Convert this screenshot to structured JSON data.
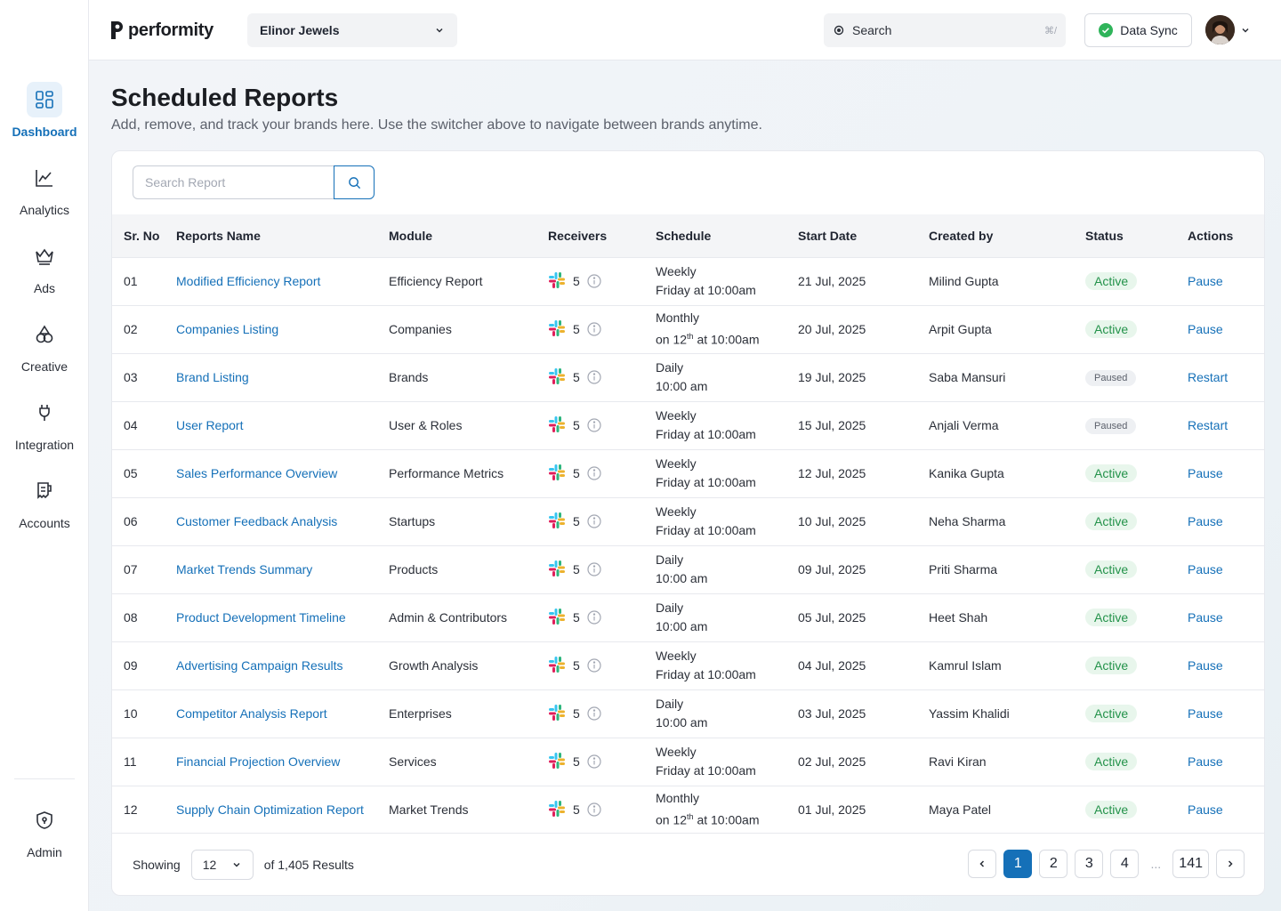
{
  "app": {
    "logo_text": "performity"
  },
  "header": {
    "brand": "Elinor Jewels",
    "search_placeholder": "Search",
    "search_shortcut": "⌘/",
    "sync_label": "Data Sync"
  },
  "sidebar": {
    "items": [
      {
        "label": "Dashboard",
        "icon": "dashboard-grid-icon",
        "active": true
      },
      {
        "label": "Analytics",
        "icon": "line-chart-icon"
      },
      {
        "label": "Ads",
        "icon": "crown-icon"
      },
      {
        "label": "Creative",
        "icon": "shapes-icon"
      },
      {
        "label": "Integration",
        "icon": "plug-icon"
      },
      {
        "label": "Accounts",
        "icon": "receipt-icon"
      }
    ],
    "admin": {
      "label": "Admin",
      "icon": "shield-icon"
    }
  },
  "page": {
    "title": "Scheduled Reports",
    "subtitle": "Add, remove, and track your brands here. Use the switcher above to navigate between brands anytime."
  },
  "report_search": {
    "placeholder": "Search Report"
  },
  "table": {
    "columns": [
      "Sr. No",
      "Reports Name",
      "Module",
      "Receivers",
      "Schedule",
      "Start Date",
      "Created by",
      "Status",
      "Actions"
    ],
    "rows": [
      {
        "sr": "01",
        "name": "Modified Efficiency Report",
        "module": "Efficiency Report",
        "receivers": "5",
        "freq": "Weekly",
        "time": "Friday at 10:00am",
        "start": "21 Jul, 2025",
        "created_by": "Milind Gupta",
        "status": "Active",
        "action": "Pause"
      },
      {
        "sr": "02",
        "name": "Companies Listing",
        "module": "Companies",
        "receivers": "5",
        "freq": "Monthly",
        "time_pre": "on 12",
        "time_sup": "th",
        "time_post": " at 10:00am",
        "start": "20 Jul, 2025",
        "created_by": "Arpit Gupta",
        "status": "Active",
        "action": "Pause"
      },
      {
        "sr": "03",
        "name": "Brand Listing",
        "module": "Brands",
        "receivers": "5",
        "freq": "Daily",
        "time": "10:00 am",
        "start": "19 Jul, 2025",
        "created_by": "Saba Mansuri",
        "status": "Paused",
        "action": "Restart"
      },
      {
        "sr": "04",
        "name": "User Report",
        "module": "User & Roles",
        "receivers": "5",
        "freq": "Weekly",
        "time": "Friday at 10:00am",
        "start": "15 Jul, 2025",
        "created_by": "Anjali Verma",
        "status": "Paused",
        "action": "Restart"
      },
      {
        "sr": "05",
        "name": "Sales Performance Overview",
        "module": "Performance Metrics",
        "receivers": "5",
        "freq": "Weekly",
        "time": "Friday at 10:00am",
        "start": "12 Jul, 2025",
        "created_by": "Kanika Gupta",
        "status": "Active",
        "action": "Pause"
      },
      {
        "sr": "06",
        "name": "Customer Feedback Analysis",
        "module": "Startups",
        "receivers": "5",
        "freq": "Weekly",
        "time": "Friday at 10:00am",
        "start": "10 Jul, 2025",
        "created_by": "Neha Sharma",
        "status": "Active",
        "action": "Pause"
      },
      {
        "sr": "07",
        "name": "Market Trends Summary",
        "module": "Products",
        "receivers": "5",
        "freq": "Daily",
        "time": "10:00 am",
        "start": "09 Jul, 2025",
        "created_by": "Priti Sharma",
        "status": "Active",
        "action": "Pause"
      },
      {
        "sr": "08",
        "name": "Product Development Timeline",
        "module": "Admin & Contributors",
        "receivers": "5",
        "freq": "Daily",
        "time": "10:00 am",
        "start": "05 Jul, 2025",
        "created_by": "Heet Shah",
        "status": "Active",
        "action": "Pause"
      },
      {
        "sr": "09",
        "name": "Advertising Campaign Results",
        "module": "Growth Analysis",
        "receivers": "5",
        "freq": "Weekly",
        "time": "Friday at 10:00am",
        "start": "04 Jul, 2025",
        "created_by": "Kamrul Islam",
        "status": "Active",
        "action": "Pause"
      },
      {
        "sr": "10",
        "name": "Competitor Analysis Report",
        "module": "Enterprises",
        "receivers": "5",
        "freq": "Daily",
        "time": "10:00 am",
        "start": "03 Jul, 2025",
        "created_by": "Yassim Khalidi",
        "status": "Active",
        "action": "Pause"
      },
      {
        "sr": "11",
        "name": "Financial Projection Overview",
        "module": "Services",
        "receivers": "5",
        "freq": "Weekly",
        "time": "Friday at 10:00am",
        "start": "02 Jul, 2025",
        "created_by": "Ravi Kiran",
        "status": "Active",
        "action": "Pause"
      },
      {
        "sr": "12",
        "name": "Supply Chain Optimization Report",
        "module": "Market Trends",
        "receivers": "5",
        "freq": "Monthly",
        "time_pre": "on 12",
        "time_sup": "th",
        "time_post": " at 10:00am",
        "start": "01 Jul, 2025",
        "created_by": "Maya Patel",
        "status": "Active",
        "action": "Pause"
      }
    ]
  },
  "footer": {
    "showing_label": "Showing",
    "per_page": "12",
    "results_label": "of 1,405 Results",
    "pages": [
      "1",
      "2",
      "3",
      "4"
    ],
    "ellipsis": "...",
    "last_page": "141",
    "current_page": "1"
  },
  "colors": {
    "accent": "#1570b8",
    "active_green": "#23924a",
    "sync_green": "#2fb45a"
  }
}
